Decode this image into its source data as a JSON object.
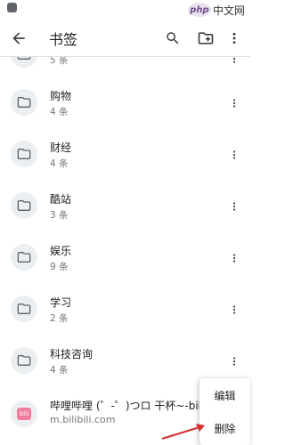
{
  "brand": {
    "logo": "php",
    "text": "中文网"
  },
  "appbar": {
    "title": "书签",
    "icons": [
      "arrow-back-icon",
      "search-icon",
      "add-folder-icon",
      "more-vert-icon"
    ]
  },
  "partial_row": {
    "count": "5 条"
  },
  "folders": [
    {
      "name": "购物",
      "count": "4 条"
    },
    {
      "name": "财经",
      "count": "4 条"
    },
    {
      "name": "酷站",
      "count": "3 条"
    },
    {
      "name": "娱乐",
      "count": "9 条"
    },
    {
      "name": "学习",
      "count": "2 条"
    },
    {
      "name": "科技咨询",
      "count": "4 条"
    }
  ],
  "bookmark": {
    "title": "哔哩哔哩 (゜-゜)つロ 干杯~-bilibili",
    "url": "m.bilibili.com",
    "icon_text": "bili"
  },
  "popup_menu": {
    "edit": "编辑",
    "delete": "删除"
  },
  "colors": {
    "folder_bg": "#eceff1",
    "icon": "#5f6368",
    "arrow": "#d32f2f",
    "bili": "#f47ba0"
  }
}
